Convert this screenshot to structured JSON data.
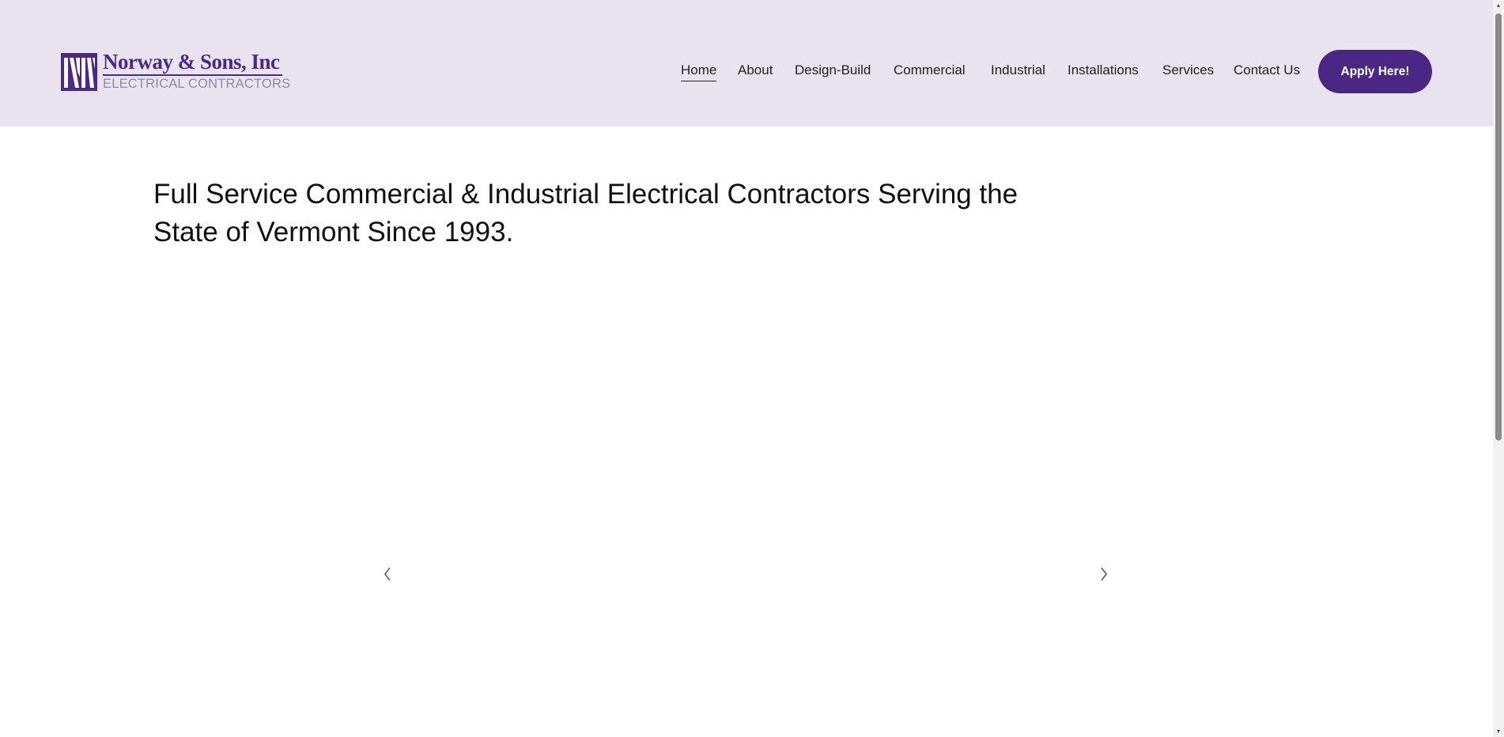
{
  "logo": {
    "name": "Norway & Sons, Inc",
    "subtitle": "ELECTRICAL CONTRACTORS",
    "brand_color": "#4a2a86",
    "sub_color": "#8f8aa3"
  },
  "nav": {
    "items": [
      {
        "label": "Home",
        "active": true
      },
      {
        "label": "About",
        "active": false
      },
      {
        "label": "Design-Build",
        "active": false
      },
      {
        "label": "Commercial",
        "active": false
      },
      {
        "label": "Industrial",
        "active": false
      },
      {
        "label": "Installations",
        "active": false
      },
      {
        "label": "Services",
        "active": false
      },
      {
        "label": "Contact Us",
        "active": false
      }
    ],
    "cta_label": "Apply Here!",
    "cta_color": "#4a2785"
  },
  "hero": {
    "headline": "Full Service Commercial & Industrial Electrical Contractors Serving the State of Vermont Since 1993."
  },
  "slider": {
    "prev_icon": "chevron-left-icon",
    "next_icon": "chevron-right-icon"
  },
  "colors": {
    "header_bg": "#e8e3ee",
    "page_bg": "#ffffff",
    "text": "#111111"
  }
}
